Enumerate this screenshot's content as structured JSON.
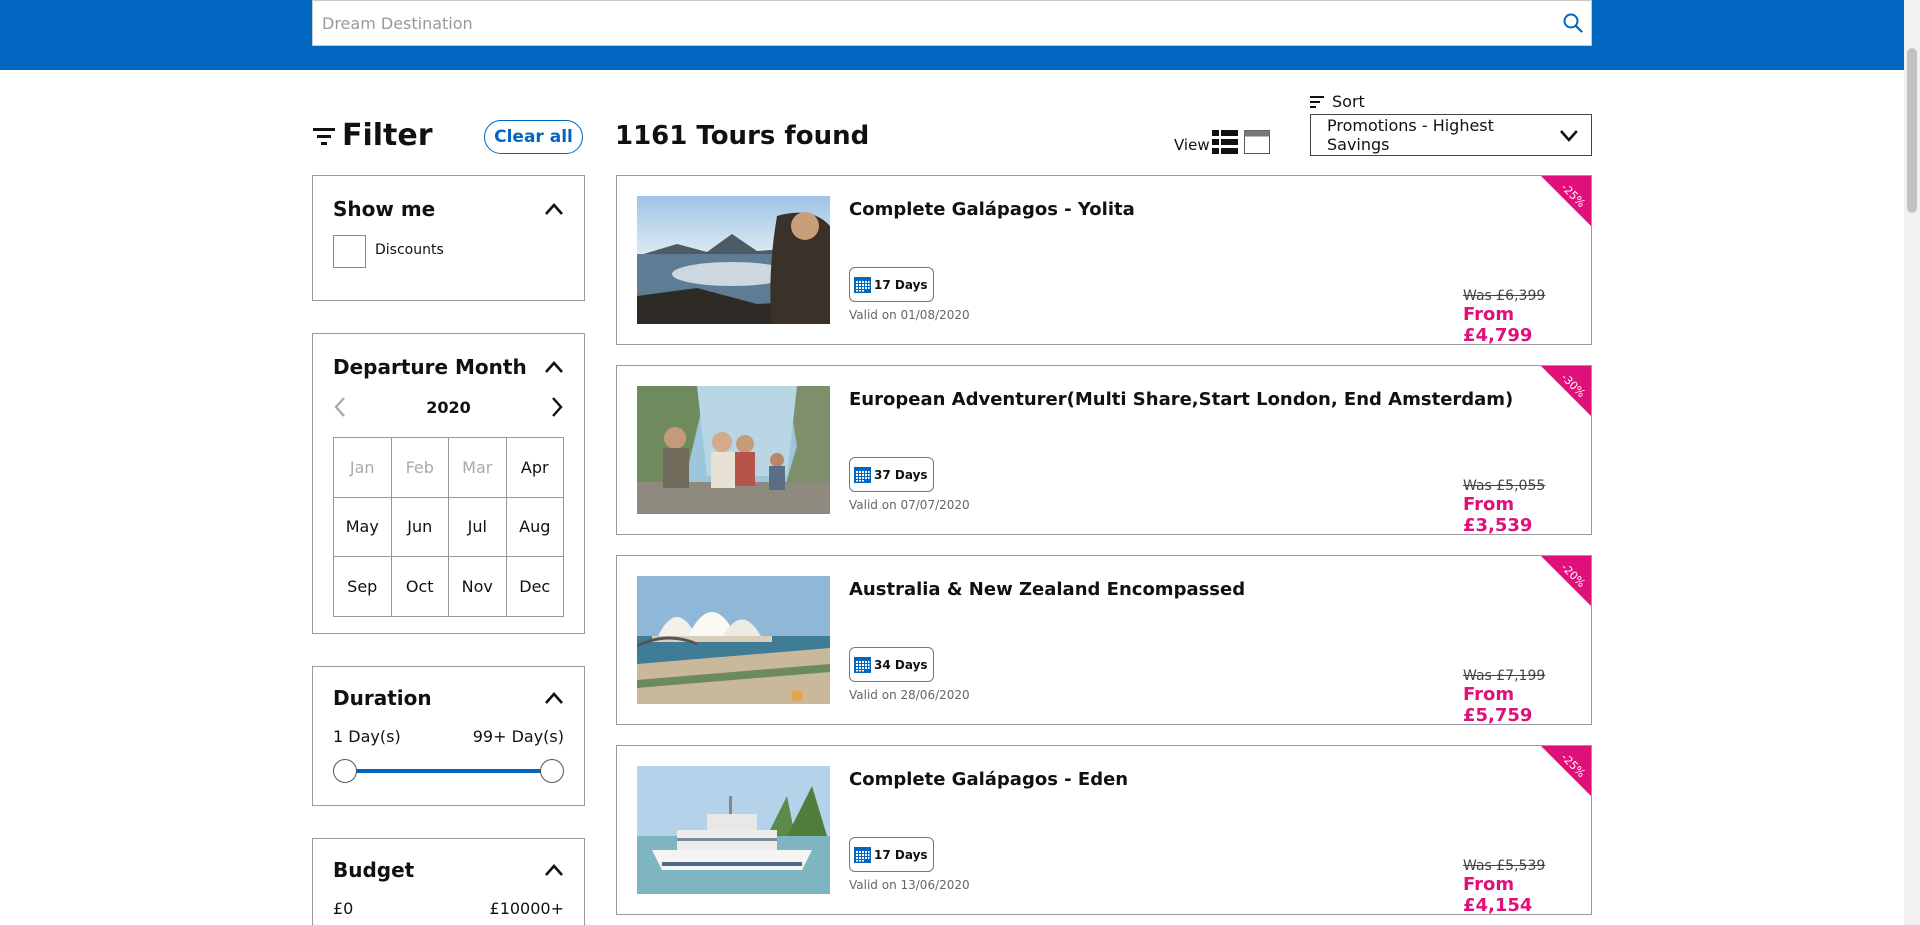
{
  "search": {
    "placeholder": "Dream Destination"
  },
  "filter": {
    "title": "Filter",
    "clear_all": "Clear all",
    "show_me": {
      "title": "Show me",
      "discounts_label": "Discounts"
    },
    "departure_month": {
      "title": "Departure Month",
      "year": "2020",
      "months": [
        {
          "label": "Jan",
          "enabled": false
        },
        {
          "label": "Feb",
          "enabled": false
        },
        {
          "label": "Mar",
          "enabled": false
        },
        {
          "label": "Apr",
          "enabled": true
        },
        {
          "label": "May",
          "enabled": true
        },
        {
          "label": "Jun",
          "enabled": true
        },
        {
          "label": "Jul",
          "enabled": true
        },
        {
          "label": "Aug",
          "enabled": true
        },
        {
          "label": "Sep",
          "enabled": true
        },
        {
          "label": "Oct",
          "enabled": true
        },
        {
          "label": "Nov",
          "enabled": true
        },
        {
          "label": "Dec",
          "enabled": true
        }
      ]
    },
    "duration": {
      "title": "Duration",
      "min_label": "1 Day(s)",
      "max_label": "99+ Day(s)"
    },
    "budget": {
      "title": "Budget",
      "min_label": "£0",
      "max_label": "£10000+"
    }
  },
  "results": {
    "count_text": "1161 Tours found",
    "view_label": "View",
    "sort_label": "Sort",
    "sort_value": "Promotions - Highest Savings",
    "tours": [
      {
        "title": "Complete Galápagos - Yolita",
        "days": "17 Days",
        "valid": "Valid on 01/08/2020",
        "was": "Was £6,399",
        "price": "From £4,799",
        "discount": "-25%"
      },
      {
        "title": "European Adventurer(Multi Share,Start London, End Amsterdam)",
        "days": "37 Days",
        "valid": "Valid on 07/07/2020",
        "was": "Was £5,055",
        "price": "From £3,539",
        "discount": "-30%"
      },
      {
        "title": "Australia & New Zealand Encompassed",
        "days": "34 Days",
        "valid": "Valid on 28/06/2020",
        "was": "Was £7,199",
        "price": "From £5,759",
        "discount": "-20%"
      },
      {
        "title": "Complete Galápagos - Eden",
        "days": "17 Days",
        "valid": "Valid on 13/06/2020",
        "was": "Was £5,539",
        "price": "From £4,154",
        "discount": "-25%"
      }
    ]
  },
  "colors": {
    "brand_blue": "#0066bf",
    "accent_pink": "#e0107a"
  }
}
